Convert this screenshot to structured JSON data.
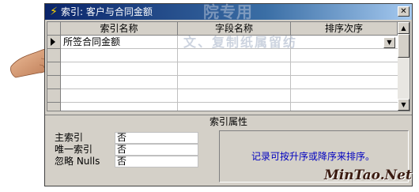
{
  "window": {
    "title_icon": "lightning-icon",
    "title": "索引: 客户与合同金额",
    "close_label": "✕"
  },
  "overlay_watermark": "院专用",
  "grid": {
    "columns": [
      "索引名称",
      "字段名称",
      "排序次序"
    ],
    "rows": [
      {
        "index_name": "所签合同金额",
        "field_name": "",
        "sort_order": ""
      }
    ],
    "watermark": "文、复制纸属留纺"
  },
  "properties": {
    "title": "索引属性",
    "items": [
      {
        "label": "主索引",
        "value": "否"
      },
      {
        "label": "唯一索引",
        "value": "否"
      },
      {
        "label": "忽略 Nulls",
        "value": "否"
      }
    ],
    "hint": "记录可按升序或降序来排序。"
  },
  "footer_watermark": "MinTao.Net",
  "colors": {
    "titlebar_start": "#0a246a",
    "titlebar_end": "#a6caf0",
    "hint_text": "#0000c0",
    "dialog_bg": "#d4d0c8"
  }
}
